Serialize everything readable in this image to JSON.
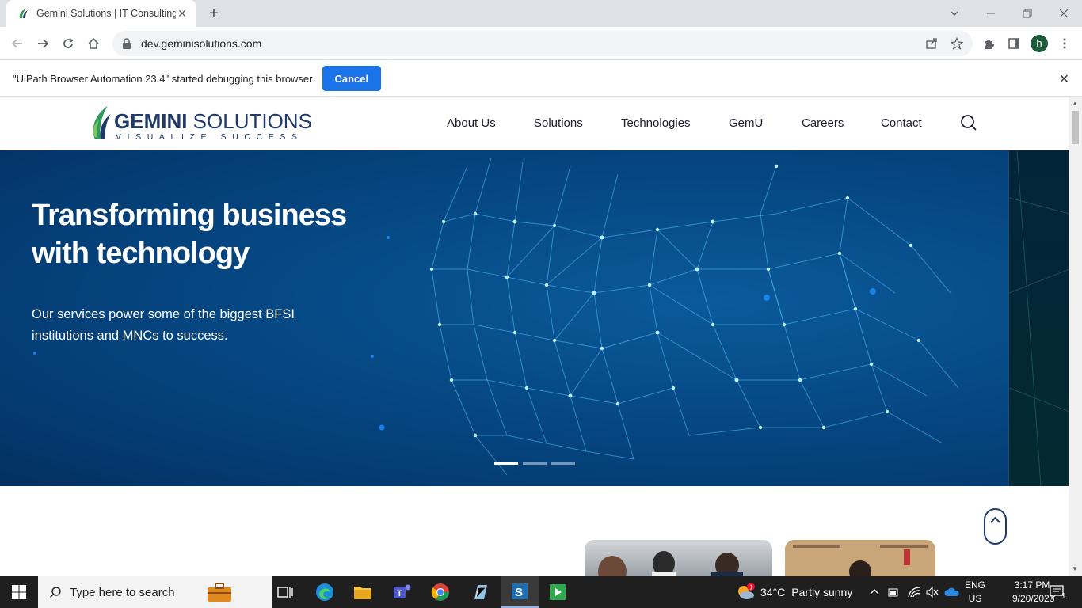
{
  "browser": {
    "tab_title": "Gemini Solutions | IT Consulting",
    "tab_close": "✕",
    "new_tab": "+",
    "url": "dev.geminisolutions.com",
    "profile_initial": "h"
  },
  "infobar": {
    "message": "\"UiPath Browser Automation 23.4\" started debugging this browser",
    "cancel_label": "Cancel",
    "close": "✕"
  },
  "site": {
    "logo_name_bold": "GEMINI",
    "logo_name_rest": " SOLUTIONS",
    "logo_tagline": "VISUALIZE SUCCESS",
    "nav": [
      "About Us",
      "Solutions",
      "Technologies",
      "GemU",
      "Careers",
      "Contact"
    ],
    "hero": {
      "headline": "Transforming business with technology",
      "subtext": "Our services power some of the biggest BFSI institutions and MNCs to success.",
      "slide_count": 3,
      "active_slide": 1
    },
    "colors": {
      "brand_navy": "#1f3a68",
      "brand_green": "#2e9b5b",
      "hero_blue": "#064a86",
      "button_blue": "#1a73e8"
    }
  },
  "taskbar": {
    "search_placeholder": "Type here to search",
    "weather_temp": "34°C",
    "weather_desc": "Partly sunny",
    "lang_top": "ENG",
    "lang_bottom": "US",
    "time": "3:17 PM",
    "date": "9/20/2023",
    "notification_count": "1"
  }
}
